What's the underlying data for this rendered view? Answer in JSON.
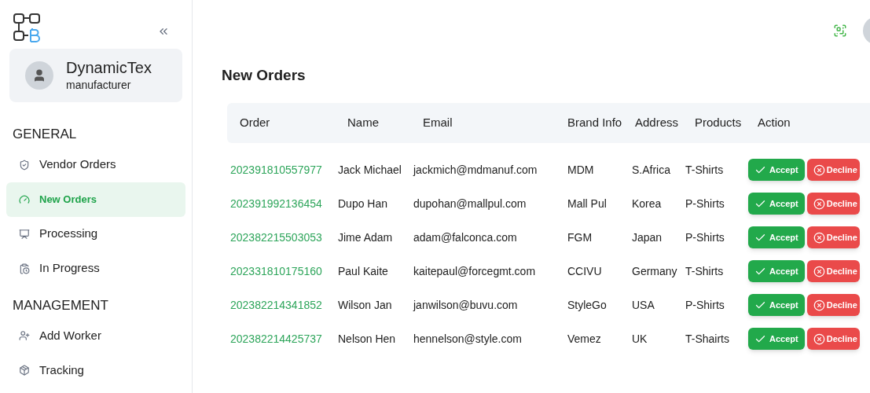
{
  "sidebar": {
    "profile": {
      "name": "DynamicTex",
      "role": "manufacturer"
    },
    "sections": [
      {
        "title": "GENERAL",
        "items": [
          {
            "label": "Vendor Orders",
            "selected": false
          },
          {
            "label": "New Orders",
            "selected": true
          },
          {
            "label": "Processing",
            "selected": false
          },
          {
            "label": "In Progress",
            "selected": false
          }
        ]
      },
      {
        "title": "MANAGEMENT",
        "items": [
          {
            "label": "Add Worker",
            "selected": false
          },
          {
            "label": "Tracking",
            "selected": false
          }
        ]
      }
    ]
  },
  "page_title": "New Orders",
  "table": {
    "columns": [
      "Order",
      "Name",
      "Email",
      "Brand Info",
      "Address",
      "Products",
      "Action"
    ],
    "rows": [
      {
        "order": "202391810557977",
        "name": "Jack Michael",
        "email": "jackmich@mdmanuf.com",
        "brand": "MDM",
        "address": "S.Africa",
        "products": "T-Shirts",
        "accept": "Accept",
        "decline": "Decline"
      },
      {
        "order": "202391992136454",
        "name": "Dupo Han",
        "email": "dupohan@mallpul.com",
        "brand": "Mall Pul",
        "address": "Korea",
        "products": "P-Shirts",
        "accept": "Accept",
        "decline": "Decline"
      },
      {
        "order": "202382215503053",
        "name": "Jime Adam",
        "email": "adam@falconca.com",
        "brand": "FGM",
        "address": "Japan",
        "products": "P-Shirts",
        "accept": "Accept",
        "decline": "Decline"
      },
      {
        "order": "202331810175160",
        "name": "Paul Kaite",
        "email": "kaitepaul@forcegmt.com",
        "brand": "CCIVU",
        "address": "Germany",
        "products": "T-Shirts",
        "accept": "Accept",
        "decline": "Decline"
      },
      {
        "order": "202382214341852",
        "name": "Wilson Jan",
        "email": "janwilson@buvu.com",
        "brand": "StyleGo",
        "address": "USA",
        "products": "P-Shirts",
        "accept": "Accept",
        "decline": "Decline"
      },
      {
        "order": "202382214425737",
        "name": "Nelson Hen",
        "email": "hennelson@style.com",
        "brand": "Vemez",
        "address": "UK",
        "products": "T-Shairts",
        "accept": "Accept",
        "decline": "Decline"
      }
    ]
  }
}
